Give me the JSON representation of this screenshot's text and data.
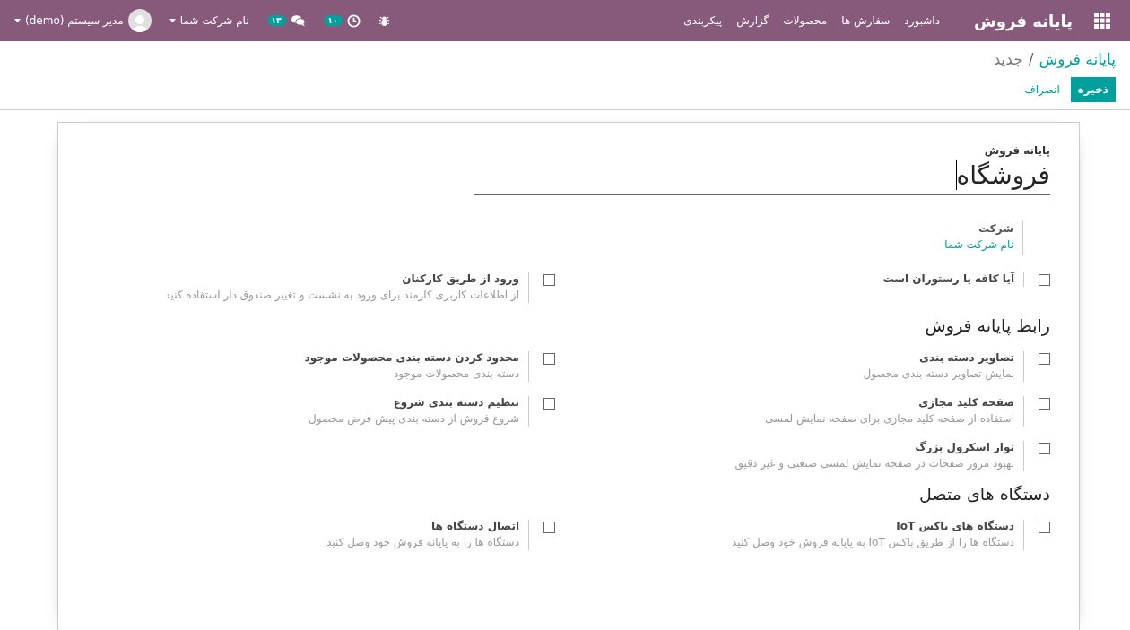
{
  "navbar": {
    "brand": "پایانه فروش",
    "menu": [
      "داشبورد",
      "سفارش ها",
      "محصولات",
      "گزارش",
      "پیکربندی"
    ],
    "activity_count": "۱۰",
    "message_count": "۱۳",
    "company": "نام شرکت شما",
    "user": "مدیر سیستم (demo)"
  },
  "breadcrumb": {
    "parent": "پایانه فروش",
    "separator": "/",
    "current": "جدید"
  },
  "buttons": [
    {
      "label": "ذخیره",
      "kind": "primary"
    },
    {
      "label": "انصراف",
      "kind": "link"
    }
  ],
  "form": {
    "name_label": "پایانه فروش",
    "name_value": "فروشگاه",
    "company_label": "شرکت",
    "company_value": "نام شرکت شما",
    "sections": [
      {
        "settings": [
          {
            "label": "آیا کافه یا رستوران است",
            "checked": false
          },
          {
            "label": "ورود از طریق کارکنان",
            "description": "از اطلاعات کاربری کارمند برای ورود به نشست و تغییر صندوق دار استفاده کنید",
            "checked": false
          }
        ]
      },
      {
        "title": "رابط پایانه فروش",
        "settings": [
          {
            "label": "تصاویر دسته بندی",
            "description": "نمایش تصاویر دسته بندی محصول",
            "checked": false
          },
          {
            "label": "محدود کردن دسته بندی محصولات موجود",
            "description": "دسته بندی محصولات موجود",
            "checked": false
          },
          {
            "label": "صفحه کلید مجازی",
            "description": "استفاده از صفحه کلید مجازی برای صفحه نمایش لمسی",
            "checked": false
          },
          {
            "label": "تنظیم دسته بندی شروع",
            "description": "شروع فروش از دسته بندی پیش فرض محصول",
            "checked": false
          },
          {
            "label": "نوار اسکرول بزرگ",
            "description": "بهبود مرور صفحات در صفحه نمایش لمسی صنعتی و غیر دقیق",
            "checked": false
          }
        ]
      },
      {
        "title": "دستگاه های متصل",
        "settings": [
          {
            "label": "دستگاه های باکس IoT",
            "description": "دستگاه ها را از طریق باکس IoT به پایانه فروش خود وصل کنید",
            "checked": false
          },
          {
            "label": "اتصال دستگاه ها",
            "description": "دستگاه ها را به پایانه فروش خود وصل کنید",
            "checked": false
          }
        ]
      }
    ]
  }
}
